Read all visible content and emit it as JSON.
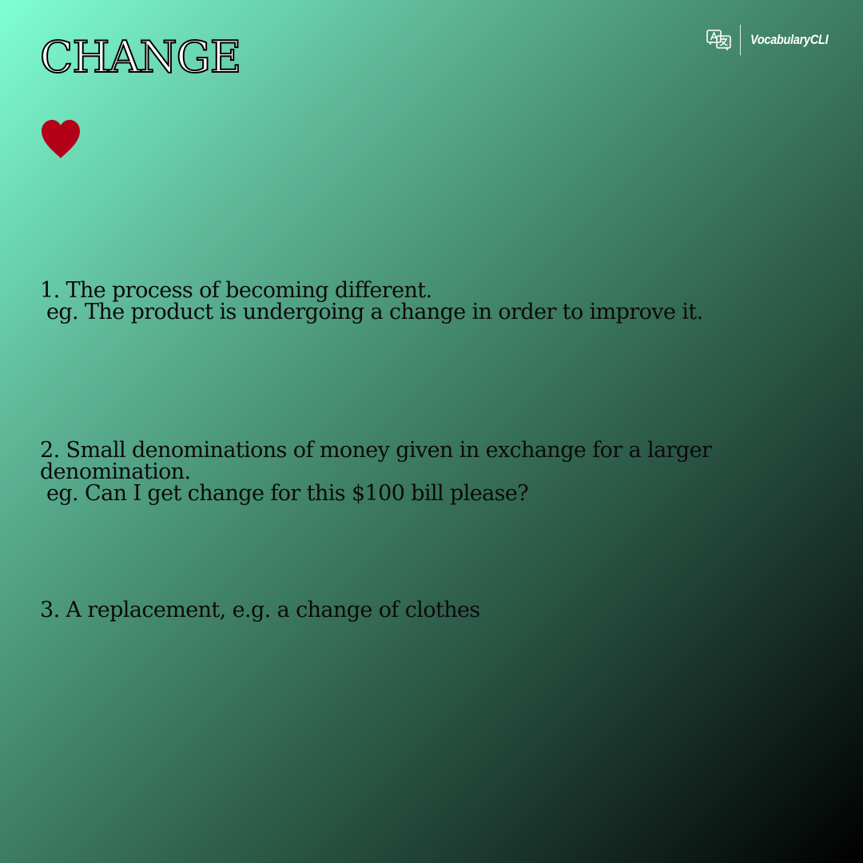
{
  "word": "CHANGE",
  "brand": {
    "name": "VocabularyCLI",
    "icon": "translate-icon"
  },
  "favorite_icon": "heart-icon",
  "colors": {
    "heart": "#b5001a",
    "gradient_start": "#7fffd4",
    "gradient_end": "#000000",
    "text": "#0a0a0a"
  },
  "definitions": [
    {
      "text": "1. The process of becoming different.",
      "example": " eg. The product is undergoing a change in order to improve it."
    },
    {
      "text": "2. Small denominations of money given in exchange for a larger denomination.",
      "example": " eg. Can I get change for this $100 bill please?"
    },
    {
      "text": "3. A replacement, e.g. a change of clothes",
      "example": ""
    }
  ]
}
